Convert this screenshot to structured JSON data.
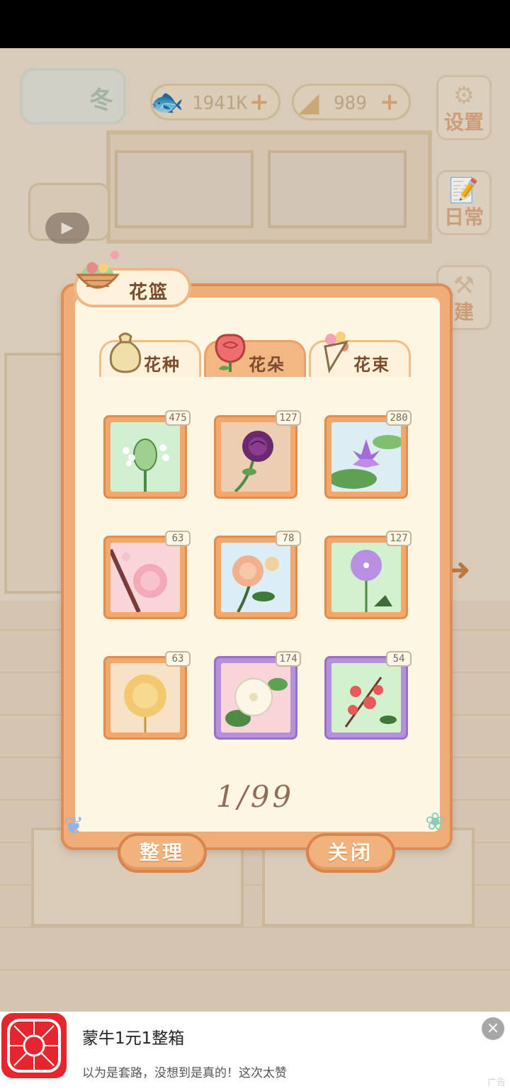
{
  "currency": {
    "fish": "1941K",
    "cheese": "989",
    "plus": "+"
  },
  "season": {
    "label": "冬"
  },
  "side_menu": {
    "settings": "设置",
    "daily": "日常",
    "build": "建"
  },
  "dialog": {
    "title": "花篮",
    "tabs": [
      {
        "label": "花种",
        "active": false
      },
      {
        "label": "花朵",
        "active": true
      },
      {
        "label": "花束",
        "active": false
      }
    ],
    "items": [
      {
        "count": "475",
        "flower": "green-hydrangea"
      },
      {
        "count": "127",
        "flower": "purple-rose"
      },
      {
        "count": "280",
        "flower": "water-lily"
      },
      {
        "count": "63",
        "flower": "pink-camellia"
      },
      {
        "count": "78",
        "flower": "peach-rose"
      },
      {
        "count": "127",
        "flower": "allium"
      },
      {
        "count": "63",
        "flower": "golden-chrysanthemum"
      },
      {
        "count": "174",
        "flower": "white-morning-glory"
      },
      {
        "count": "54",
        "flower": "red-blossom"
      }
    ],
    "pager": "1/99",
    "organize_button": "整理",
    "close_button": "关闭"
  },
  "ad": {
    "title": "蒙牛1元1整箱",
    "subtitle": "以为是套路，没想到是真的！这次太赞",
    "tag": "广告",
    "close": "×",
    "logo_text": "拼"
  }
}
